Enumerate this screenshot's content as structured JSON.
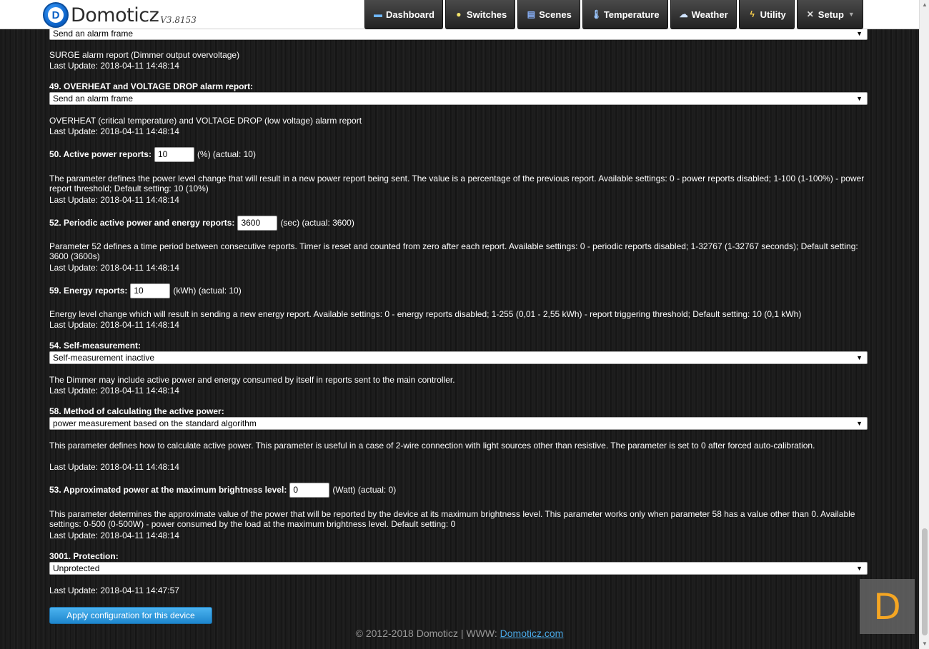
{
  "app": {
    "logo_letter": "D",
    "name": "Domoticz",
    "version": "V3.8153"
  },
  "nav": [
    {
      "label": "Dashboard",
      "icon": "dashboard-icon"
    },
    {
      "label": "Switches",
      "icon": "lightbulb-icon"
    },
    {
      "label": "Scenes",
      "icon": "scenes-icon"
    },
    {
      "label": "Temperature",
      "icon": "thermometer-icon"
    },
    {
      "label": "Weather",
      "icon": "weather-icon"
    },
    {
      "label": "Utility",
      "icon": "utility-icon"
    },
    {
      "label": "Setup",
      "icon": "tools-icon"
    }
  ],
  "params": {
    "surge": {
      "select_value": "Send an alarm frame",
      "description": "SURGE alarm report (Dimmer output overvoltage)",
      "last_update": "Last Update: 2018-04-11 14:48:14"
    },
    "p49": {
      "label": "49. OVERHEAT and VOLTAGE DROP alarm report:",
      "select_value": "Send an alarm frame",
      "description": "OVERHEAT (critical temperature) and VOLTAGE DROP (low voltage) alarm report",
      "last_update": "Last Update: 2018-04-11 14:48:14"
    },
    "p50": {
      "label": "50. Active power reports:",
      "value": "10",
      "suffix": "(%) (actual: 10)",
      "description": "The parameter defines the power level change that will result in a new power report being sent. The value is a percentage of the previous report. Available settings: 0 - power reports disabled; 1-100 (1-100%) - power report threshold; Default setting: 10 (10%)",
      "last_update": "Last Update: 2018-04-11 14:48:14"
    },
    "p52": {
      "label": "52. Periodic active power and energy reports:",
      "value": "3600",
      "suffix": "(sec) (actual: 3600)",
      "description": "Parameter 52 defines a time period between consecutive reports. Timer is reset and counted from zero after each report. Available settings: 0 - periodic reports disabled; 1-32767 (1-32767 seconds); Default setting: 3600 (3600s)",
      "last_update": "Last Update: 2018-04-11 14:48:14"
    },
    "p59": {
      "label": "59. Energy reports:",
      "value": "10",
      "suffix": "(kWh) (actual: 10)",
      "description": "Energy level change which will result in sending a new energy report. Available settings: 0 - energy reports disabled; 1-255 (0,01 - 2,55 kWh) - report triggering threshold; Default setting: 10 (0,1 kWh)",
      "last_update": "Last Update: 2018-04-11 14:48:14"
    },
    "p54": {
      "label": "54. Self-measurement:",
      "select_value": "Self-measurement inactive",
      "description": "The Dimmer may include active power and energy consumed by itself in reports sent to the main controller.",
      "last_update": "Last Update: 2018-04-11 14:48:14"
    },
    "p58": {
      "label": "58. Method of calculating the active power:",
      "select_value": "power measurement based on the standard algorithm",
      "description": "This parameter defines how to calculate active power. This parameter is useful in a case of 2-wire connection with light sources other than resistive. The parameter is set to 0 after forced auto-calibration.",
      "last_update": "Last Update: 2018-04-11 14:48:14"
    },
    "p53": {
      "label": "53. Approximated power at the maximum brightness level:",
      "value": "0",
      "suffix": "(Watt) (actual: 0)",
      "description": "This parameter determines the approximate value of the power that will be reported by the device at its maximum brightness level. This parameter works only when parameter 58 has a value other than 0. Available settings: 0-500 (0-500W) - power consumed by the load at the maximum brightness level. Default setting: 0",
      "last_update": "Last Update: 2018-04-11 14:48:14"
    },
    "p3001": {
      "label": "3001. Protection:",
      "select_value": "Unprotected",
      "last_update": "Last Update: 2018-04-11 14:47:57"
    }
  },
  "apply_button": "Apply configuration for this device",
  "footer": {
    "text": "© 2012-2018 Domoticz | WWW: ",
    "link": "Domoticz.com"
  },
  "badge_letter": "D"
}
